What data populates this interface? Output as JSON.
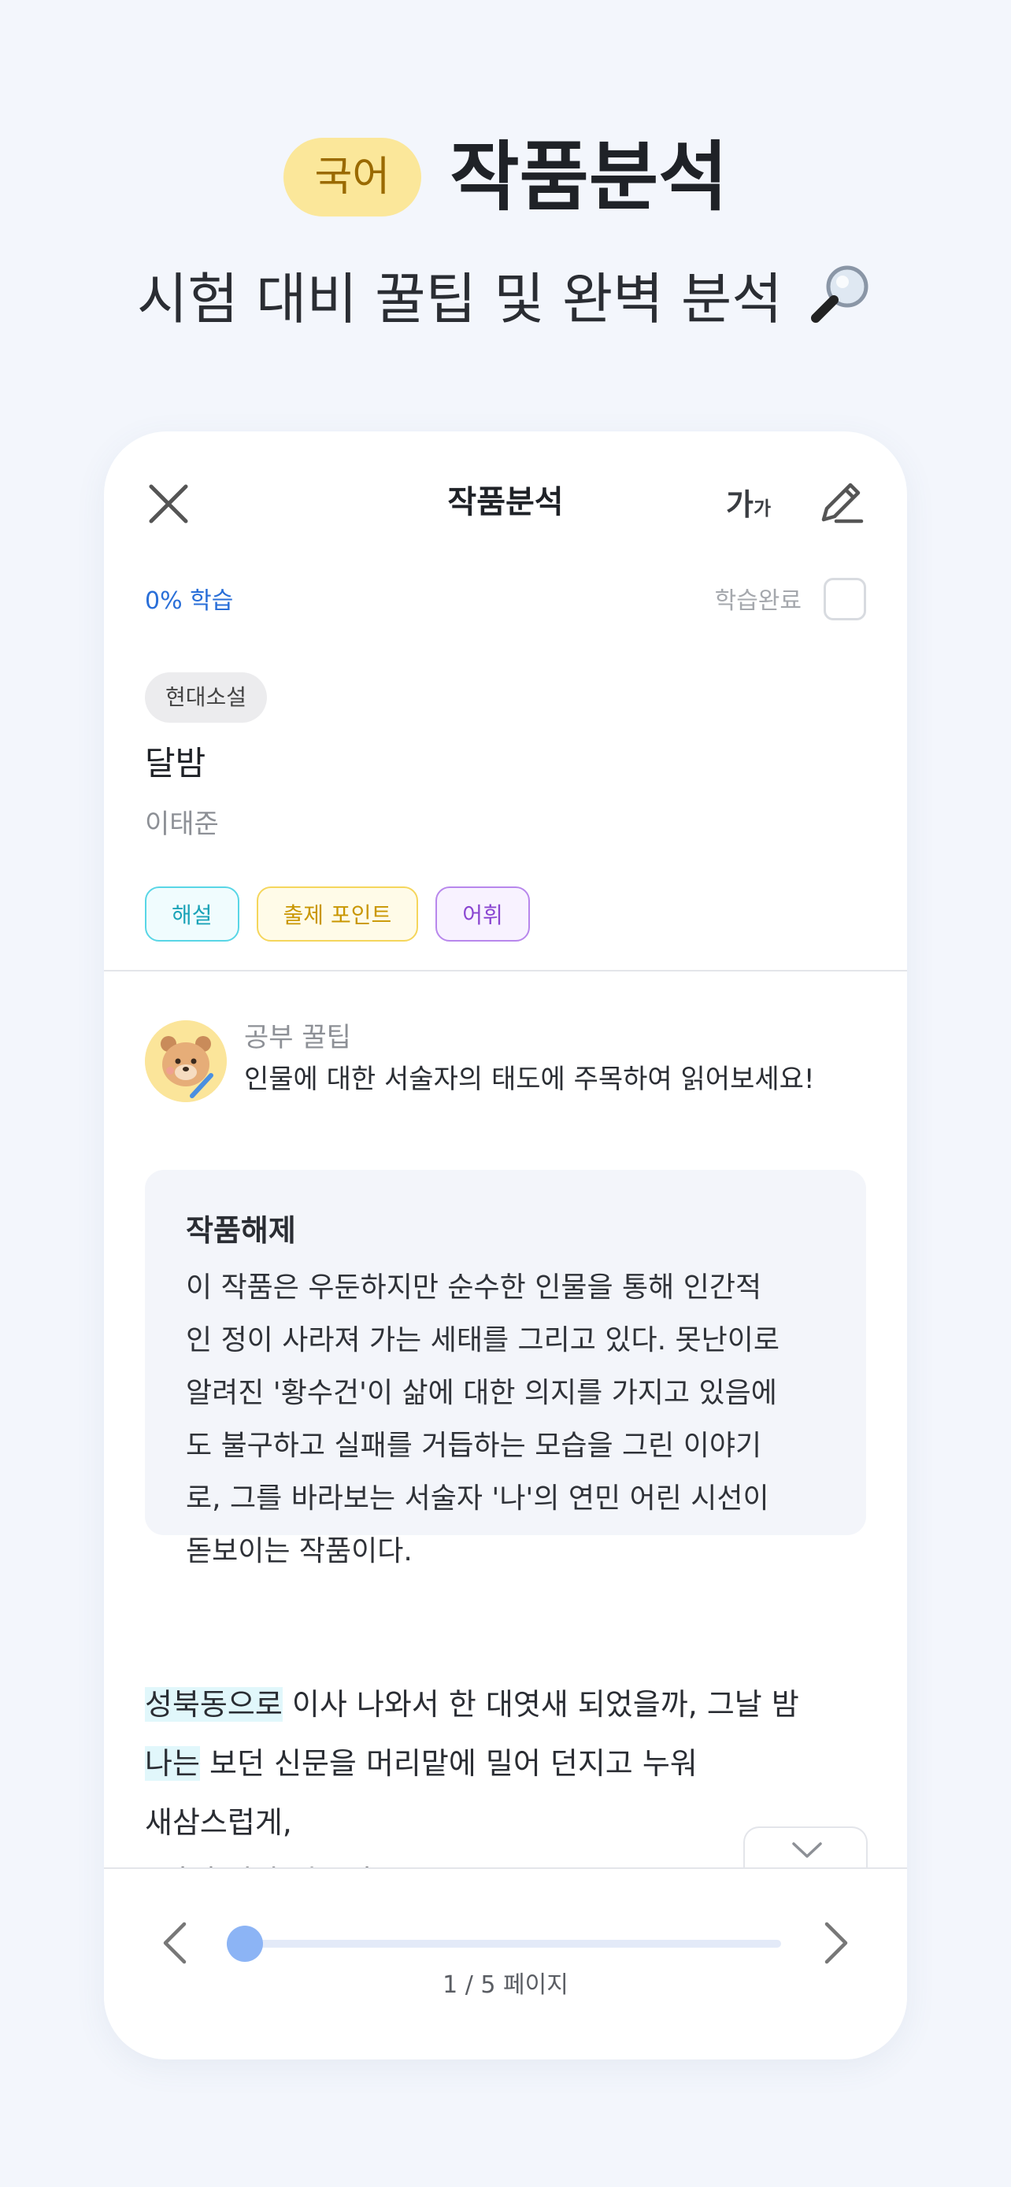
{
  "hero": {
    "subject": "국어",
    "title": "작품분석",
    "subtitle": "시험 대비 꿀팁 및 완벽 분석"
  },
  "header": {
    "title": "작품분석",
    "font_size_label_big": "가",
    "font_size_label_small": "가"
  },
  "progress": {
    "label": "0% 학습",
    "done_label": "학습완료",
    "done_checked": false
  },
  "work": {
    "genre": "현대소설",
    "title": "달밤",
    "author": "이태준"
  },
  "tags": [
    "해설",
    "출제 포인트",
    "어휘"
  ],
  "tip": {
    "label": "공부 꿀팁",
    "text": "인물에 대한 서술자의 태도에 주목하여 읽어보세요!"
  },
  "analysis": {
    "title": "작품해제",
    "lines": [
      "이 작품은 우둔하지만 순수한 인물을 통해 인간적",
      "인 정이 사라져 가는 세태를 그리고 있다. 못난이로",
      "알려진 '황수건'이 삶에 대한 의지를 가지고 있음에",
      "도 불구하고 실패를 거듭하는 모습을 그린 이야기",
      "로, 그를 바라보는 서술자 '나'의 연민 어린 시선이",
      "돋보이는 작품이다."
    ]
  },
  "passage": {
    "line1_highlight": "성북동으로",
    "line1_rest": " 이사 나와서 한 대엿새 되었을까, 그날 밤",
    "line2_highlight": "나는",
    "line2_rest": " 보던 신문을 머리맡에 밀어 던지고 누워",
    "line3": "새삼스럽게,",
    "line4": "“이젠 정말 시골이로군!”"
  },
  "pager": {
    "current_page": 1,
    "total_pages": 5,
    "label": "1 / 5 페이지"
  },
  "colors": {
    "accent": "#2a6fd8",
    "subject_pill": "#fbe79a",
    "slider_thumb": "#8cb4f5",
    "highlight": "#e1f7fb"
  }
}
